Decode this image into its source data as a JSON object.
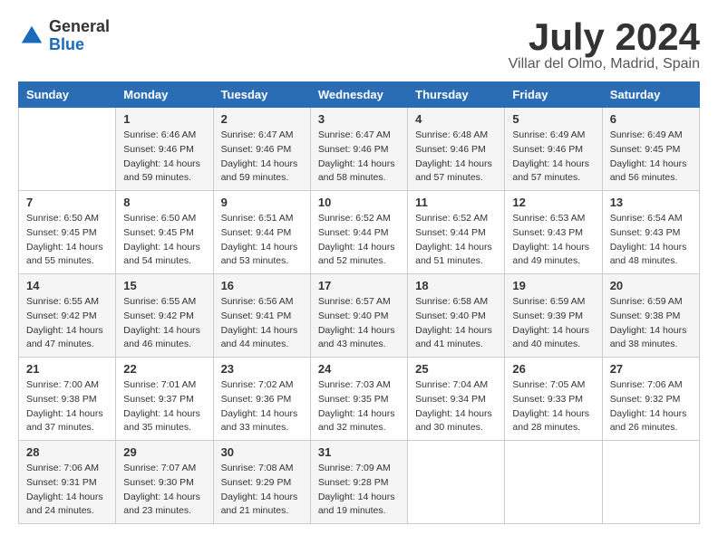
{
  "header": {
    "logo_general": "General",
    "logo_blue": "Blue",
    "title": "July 2024",
    "subtitle": "Villar del Olmo, Madrid, Spain"
  },
  "calendar": {
    "days_of_week": [
      "Sunday",
      "Monday",
      "Tuesday",
      "Wednesday",
      "Thursday",
      "Friday",
      "Saturday"
    ],
    "weeks": [
      [
        {
          "day": "",
          "sunrise": "",
          "sunset": "",
          "daylight": ""
        },
        {
          "day": "1",
          "sunrise": "Sunrise: 6:46 AM",
          "sunset": "Sunset: 9:46 PM",
          "daylight": "Daylight: 14 hours and 59 minutes."
        },
        {
          "day": "2",
          "sunrise": "Sunrise: 6:47 AM",
          "sunset": "Sunset: 9:46 PM",
          "daylight": "Daylight: 14 hours and 59 minutes."
        },
        {
          "day": "3",
          "sunrise": "Sunrise: 6:47 AM",
          "sunset": "Sunset: 9:46 PM",
          "daylight": "Daylight: 14 hours and 58 minutes."
        },
        {
          "day": "4",
          "sunrise": "Sunrise: 6:48 AM",
          "sunset": "Sunset: 9:46 PM",
          "daylight": "Daylight: 14 hours and 57 minutes."
        },
        {
          "day": "5",
          "sunrise": "Sunrise: 6:49 AM",
          "sunset": "Sunset: 9:46 PM",
          "daylight": "Daylight: 14 hours and 57 minutes."
        },
        {
          "day": "6",
          "sunrise": "Sunrise: 6:49 AM",
          "sunset": "Sunset: 9:45 PM",
          "daylight": "Daylight: 14 hours and 56 minutes."
        }
      ],
      [
        {
          "day": "7",
          "sunrise": "Sunrise: 6:50 AM",
          "sunset": "Sunset: 9:45 PM",
          "daylight": "Daylight: 14 hours and 55 minutes."
        },
        {
          "day": "8",
          "sunrise": "Sunrise: 6:50 AM",
          "sunset": "Sunset: 9:45 PM",
          "daylight": "Daylight: 14 hours and 54 minutes."
        },
        {
          "day": "9",
          "sunrise": "Sunrise: 6:51 AM",
          "sunset": "Sunset: 9:44 PM",
          "daylight": "Daylight: 14 hours and 53 minutes."
        },
        {
          "day": "10",
          "sunrise": "Sunrise: 6:52 AM",
          "sunset": "Sunset: 9:44 PM",
          "daylight": "Daylight: 14 hours and 52 minutes."
        },
        {
          "day": "11",
          "sunrise": "Sunrise: 6:52 AM",
          "sunset": "Sunset: 9:44 PM",
          "daylight": "Daylight: 14 hours and 51 minutes."
        },
        {
          "day": "12",
          "sunrise": "Sunrise: 6:53 AM",
          "sunset": "Sunset: 9:43 PM",
          "daylight": "Daylight: 14 hours and 49 minutes."
        },
        {
          "day": "13",
          "sunrise": "Sunrise: 6:54 AM",
          "sunset": "Sunset: 9:43 PM",
          "daylight": "Daylight: 14 hours and 48 minutes."
        }
      ],
      [
        {
          "day": "14",
          "sunrise": "Sunrise: 6:55 AM",
          "sunset": "Sunset: 9:42 PM",
          "daylight": "Daylight: 14 hours and 47 minutes."
        },
        {
          "day": "15",
          "sunrise": "Sunrise: 6:55 AM",
          "sunset": "Sunset: 9:42 PM",
          "daylight": "Daylight: 14 hours and 46 minutes."
        },
        {
          "day": "16",
          "sunrise": "Sunrise: 6:56 AM",
          "sunset": "Sunset: 9:41 PM",
          "daylight": "Daylight: 14 hours and 44 minutes."
        },
        {
          "day": "17",
          "sunrise": "Sunrise: 6:57 AM",
          "sunset": "Sunset: 9:40 PM",
          "daylight": "Daylight: 14 hours and 43 minutes."
        },
        {
          "day": "18",
          "sunrise": "Sunrise: 6:58 AM",
          "sunset": "Sunset: 9:40 PM",
          "daylight": "Daylight: 14 hours and 41 minutes."
        },
        {
          "day": "19",
          "sunrise": "Sunrise: 6:59 AM",
          "sunset": "Sunset: 9:39 PM",
          "daylight": "Daylight: 14 hours and 40 minutes."
        },
        {
          "day": "20",
          "sunrise": "Sunrise: 6:59 AM",
          "sunset": "Sunset: 9:38 PM",
          "daylight": "Daylight: 14 hours and 38 minutes."
        }
      ],
      [
        {
          "day": "21",
          "sunrise": "Sunrise: 7:00 AM",
          "sunset": "Sunset: 9:38 PM",
          "daylight": "Daylight: 14 hours and 37 minutes."
        },
        {
          "day": "22",
          "sunrise": "Sunrise: 7:01 AM",
          "sunset": "Sunset: 9:37 PM",
          "daylight": "Daylight: 14 hours and 35 minutes."
        },
        {
          "day": "23",
          "sunrise": "Sunrise: 7:02 AM",
          "sunset": "Sunset: 9:36 PM",
          "daylight": "Daylight: 14 hours and 33 minutes."
        },
        {
          "day": "24",
          "sunrise": "Sunrise: 7:03 AM",
          "sunset": "Sunset: 9:35 PM",
          "daylight": "Daylight: 14 hours and 32 minutes."
        },
        {
          "day": "25",
          "sunrise": "Sunrise: 7:04 AM",
          "sunset": "Sunset: 9:34 PM",
          "daylight": "Daylight: 14 hours and 30 minutes."
        },
        {
          "day": "26",
          "sunrise": "Sunrise: 7:05 AM",
          "sunset": "Sunset: 9:33 PM",
          "daylight": "Daylight: 14 hours and 28 minutes."
        },
        {
          "day": "27",
          "sunrise": "Sunrise: 7:06 AM",
          "sunset": "Sunset: 9:32 PM",
          "daylight": "Daylight: 14 hours and 26 minutes."
        }
      ],
      [
        {
          "day": "28",
          "sunrise": "Sunrise: 7:06 AM",
          "sunset": "Sunset: 9:31 PM",
          "daylight": "Daylight: 14 hours and 24 minutes."
        },
        {
          "day": "29",
          "sunrise": "Sunrise: 7:07 AM",
          "sunset": "Sunset: 9:30 PM",
          "daylight": "Daylight: 14 hours and 23 minutes."
        },
        {
          "day": "30",
          "sunrise": "Sunrise: 7:08 AM",
          "sunset": "Sunset: 9:29 PM",
          "daylight": "Daylight: 14 hours and 21 minutes."
        },
        {
          "day": "31",
          "sunrise": "Sunrise: 7:09 AM",
          "sunset": "Sunset: 9:28 PM",
          "daylight": "Daylight: 14 hours and 19 minutes."
        },
        {
          "day": "",
          "sunrise": "",
          "sunset": "",
          "daylight": ""
        },
        {
          "day": "",
          "sunrise": "",
          "sunset": "",
          "daylight": ""
        },
        {
          "day": "",
          "sunrise": "",
          "sunset": "",
          "daylight": ""
        }
      ]
    ]
  }
}
